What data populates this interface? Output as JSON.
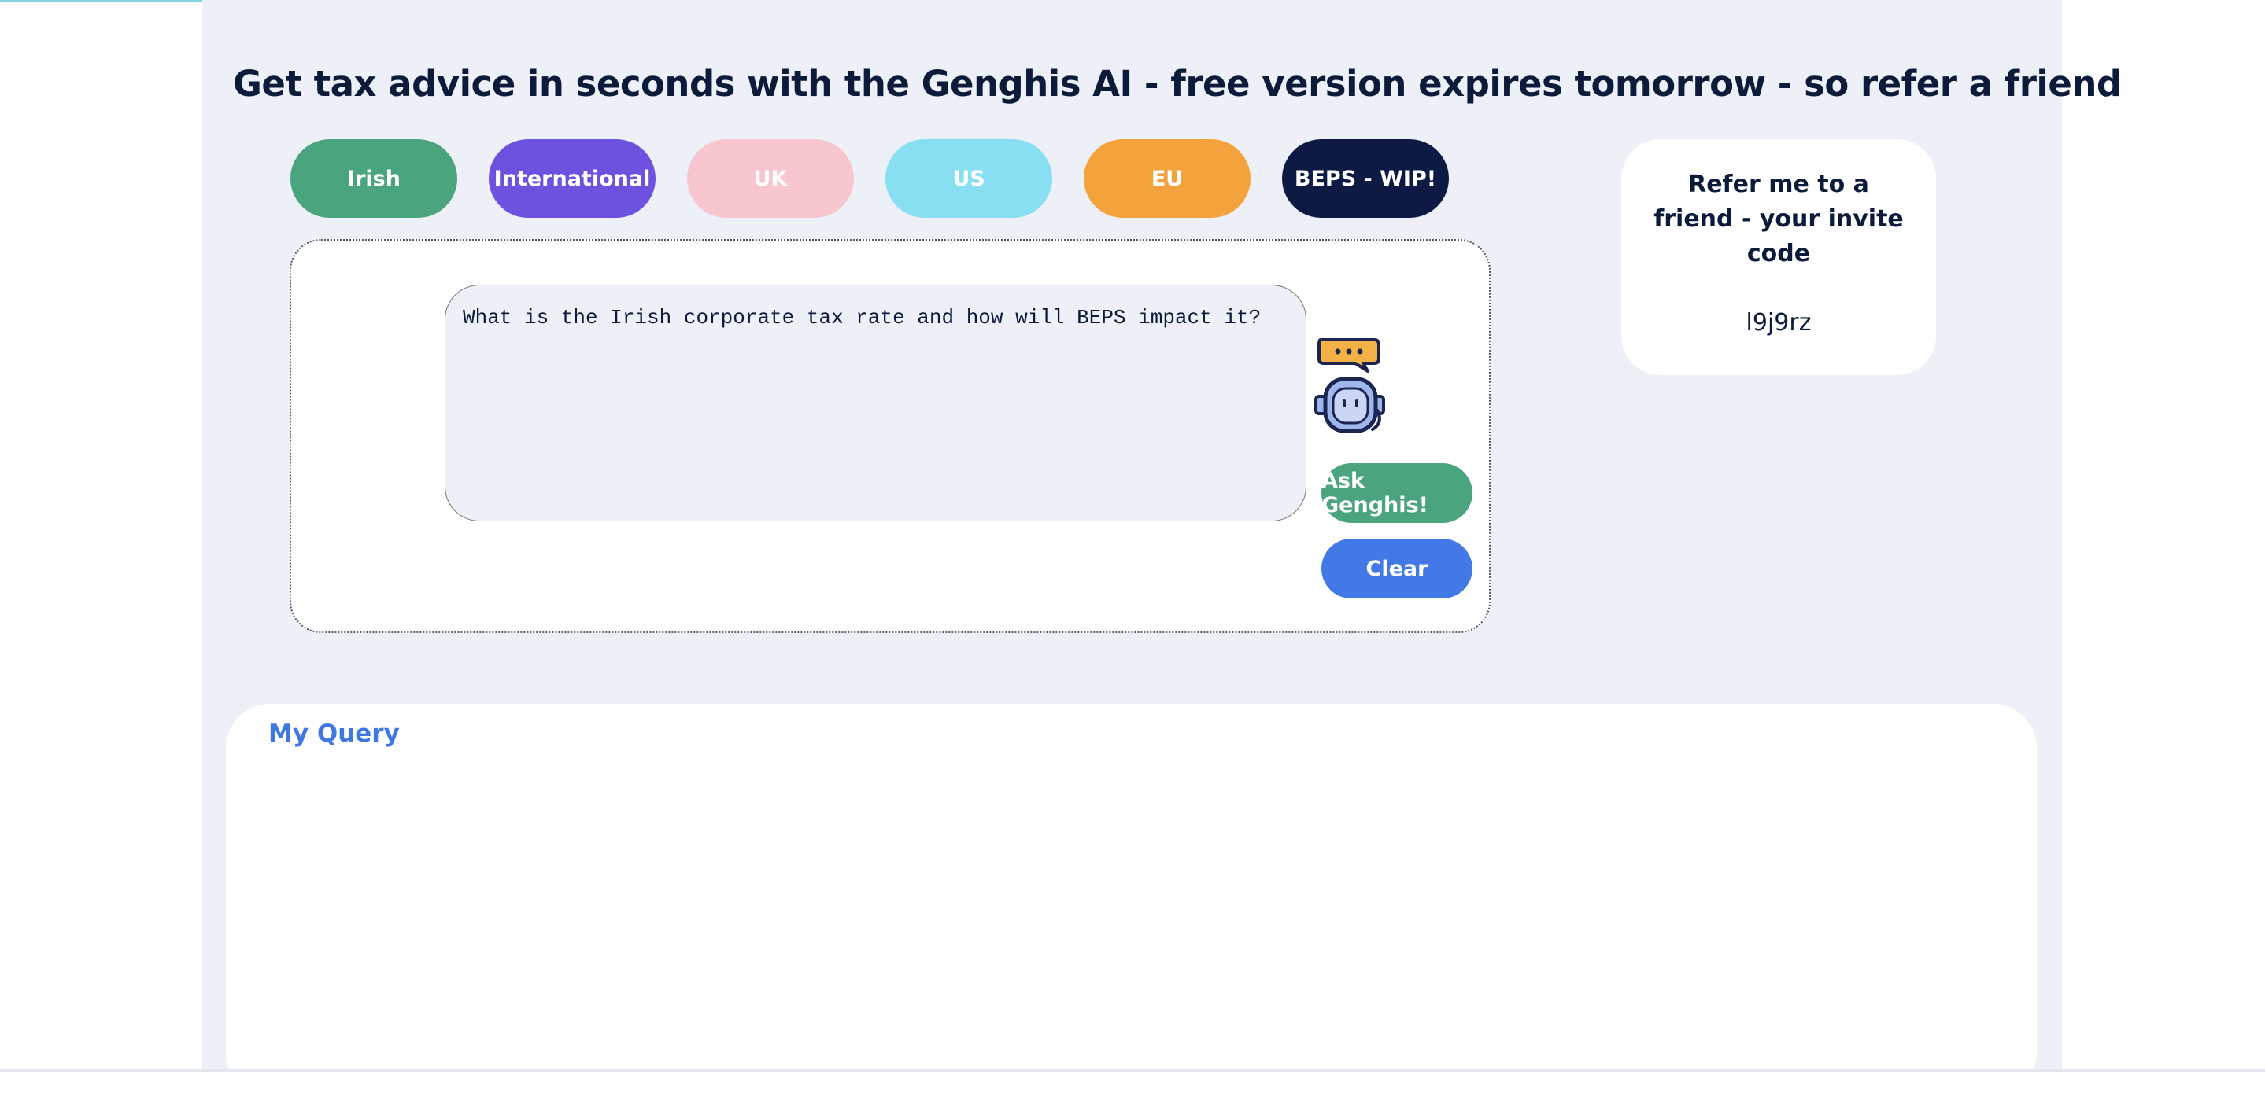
{
  "headline": "Get tax advice in seconds with the Genghis AI - free version expires tomorrow - so refer a friend",
  "tabs": [
    {
      "label": "Irish",
      "color": "#4aa57e"
    },
    {
      "label": "International",
      "color": "#6c52df"
    },
    {
      "label": "UK",
      "color": "#f7c6ce"
    },
    {
      "label": "US",
      "color": "#88dff2"
    },
    {
      "label": "EU",
      "color": "#f4a23b"
    },
    {
      "label": "BEPS - WIP!",
      "color": "#0c1a44"
    }
  ],
  "query": {
    "value": "What is the Irish corporate tax rate and how will BEPS impact it?"
  },
  "buttons": {
    "ask_label": "Ask Genghis!",
    "ask_color": "#4aa57e",
    "clear_label": "Clear",
    "clear_color": "#4279e6"
  },
  "robot_icon": "chatbot-icon",
  "referral": {
    "title": "Refer me to a friend - your invite code",
    "code": "l9j9rz"
  },
  "results": {
    "title": "My Query"
  }
}
